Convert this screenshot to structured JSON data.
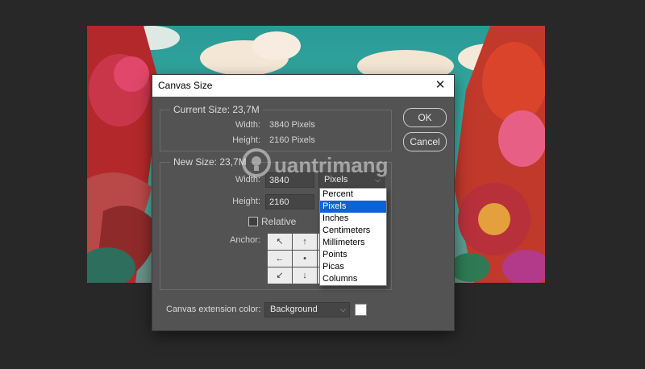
{
  "dialog": {
    "title": "Canvas Size",
    "close_glyph": "✕",
    "current_size": {
      "legend": "Current Size: 23,7M",
      "width_label": "Width:",
      "width_value": "3840 Pixels",
      "height_label": "Height:",
      "height_value": "2160 Pixels"
    },
    "new_size": {
      "legend": "New Size: 23,7M",
      "width_label": "Width:",
      "width_value": "3840",
      "height_label": "Height:",
      "height_value": "2160",
      "unit_selected": "Pixels",
      "relative_label": "Relative",
      "anchor_label": "Anchor:"
    },
    "anchor_arrows": [
      "↖",
      "↑",
      "↗",
      "←",
      "•",
      "→",
      "↙",
      "↓",
      "↘"
    ],
    "buttons": {
      "ok": "OK",
      "cancel": "Cancel"
    },
    "extension_color": {
      "label": "Canvas extension color:",
      "value": "Background",
      "swatch_color": "#ffffff"
    },
    "unit_options": [
      "Percent",
      "Pixels",
      "Inches",
      "Centimeters",
      "Millimeters",
      "Points",
      "Picas",
      "Columns"
    ],
    "unit_options_highlighted": "Pixels"
  },
  "watermark": {
    "text": "uantrimang"
  },
  "colors": {
    "workspace": "#282828",
    "dialog_bg": "#535353",
    "selection": "#0a64d6"
  }
}
